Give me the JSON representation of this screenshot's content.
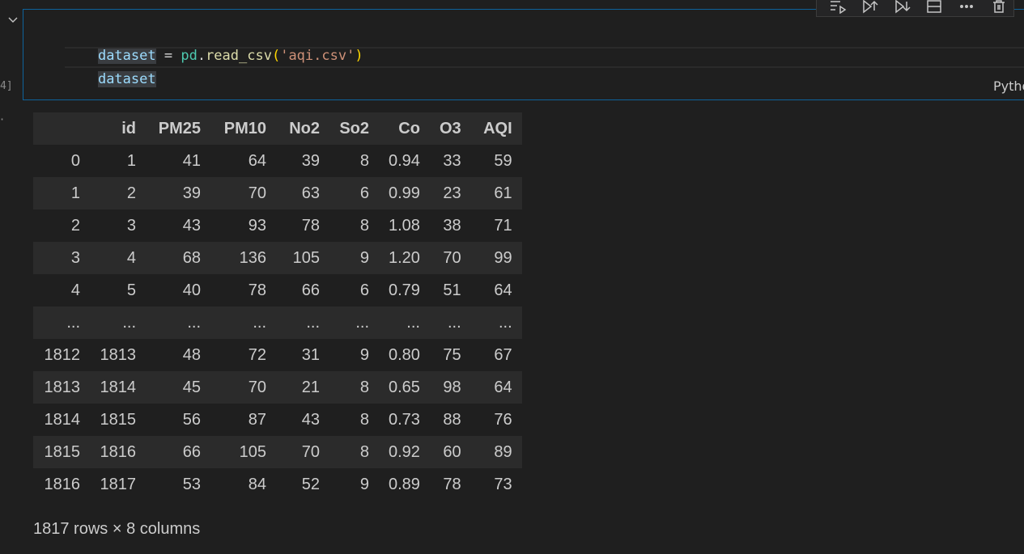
{
  "cell": {
    "execution_count": "4]",
    "language": "Python",
    "code": {
      "line1": {
        "var": "dataset",
        "op": " = ",
        "module": "pd",
        "dot": ".",
        "fn": "read_csv",
        "open": "(",
        "str": "'aqi.csv'",
        "close": ")"
      },
      "line2": {
        "var": "dataset"
      }
    },
    "toolbar": [
      "run-by-line-icon",
      "execute-above-icon",
      "execute-below-icon",
      "split-cell-icon",
      "more-icon",
      "delete-icon"
    ]
  },
  "output": {
    "marker": "·",
    "columns": [
      "",
      "id",
      "PM25",
      "PM10",
      "No2",
      "So2",
      "Co",
      "O3",
      "AQI"
    ],
    "rows": [
      [
        "0",
        "1",
        "41",
        "64",
        "39",
        "8",
        "0.94",
        "33",
        "59"
      ],
      [
        "1",
        "2",
        "39",
        "70",
        "63",
        "6",
        "0.99",
        "23",
        "61"
      ],
      [
        "2",
        "3",
        "43",
        "93",
        "78",
        "8",
        "1.08",
        "38",
        "71"
      ],
      [
        "3",
        "4",
        "68",
        "136",
        "105",
        "9",
        "1.20",
        "70",
        "99"
      ],
      [
        "4",
        "5",
        "40",
        "78",
        "66",
        "6",
        "0.79",
        "51",
        "64"
      ],
      [
        "...",
        "...",
        "...",
        "...",
        "...",
        "...",
        "...",
        "...",
        "..."
      ],
      [
        "1812",
        "1813",
        "48",
        "72",
        "31",
        "9",
        "0.80",
        "75",
        "67"
      ],
      [
        "1813",
        "1814",
        "45",
        "70",
        "21",
        "8",
        "0.65",
        "98",
        "64"
      ],
      [
        "1814",
        "1815",
        "56",
        "87",
        "43",
        "8",
        "0.73",
        "88",
        "76"
      ],
      [
        "1815",
        "1816",
        "66",
        "105",
        "70",
        "8",
        "0.92",
        "60",
        "89"
      ],
      [
        "1816",
        "1817",
        "53",
        "84",
        "52",
        "9",
        "0.89",
        "78",
        "73"
      ]
    ],
    "footer": "1817 rows × 8 columns"
  }
}
